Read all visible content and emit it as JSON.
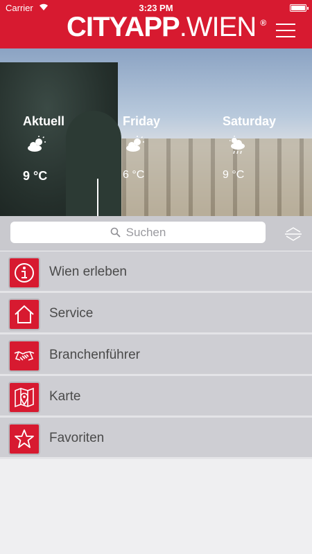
{
  "status_bar": {
    "carrier": "Carrier",
    "time": "3:23 PM",
    "battery_level": 1.0
  },
  "header": {
    "logo_bold": "CITYAPP",
    "logo_light": ".WIEN",
    "logo_mark": "®"
  },
  "weather": [
    {
      "day": "Aktuell",
      "icon": "sun-behind-cloud-icon",
      "temp": "9 °C"
    },
    {
      "day": "Friday",
      "icon": "sun-behind-cloud-icon",
      "temp": "6 °C"
    },
    {
      "day": "Saturday",
      "icon": "sun-rain-cloud-icon",
      "temp": "9 °C"
    }
  ],
  "search": {
    "placeholder": "Suchen"
  },
  "menu": [
    {
      "label": "Wien erleben",
      "icon": "info-icon"
    },
    {
      "label": "Service",
      "icon": "home-icon"
    },
    {
      "label": "Branchenführer",
      "icon": "handshake-icon"
    },
    {
      "label": "Karte",
      "icon": "map-pin-icon"
    },
    {
      "label": "Favoriten",
      "icon": "star-icon"
    }
  ],
  "colors": {
    "brand_red": "#d71a30",
    "row_bg": "#ceced3",
    "search_bg": "#c9c9ce"
  }
}
